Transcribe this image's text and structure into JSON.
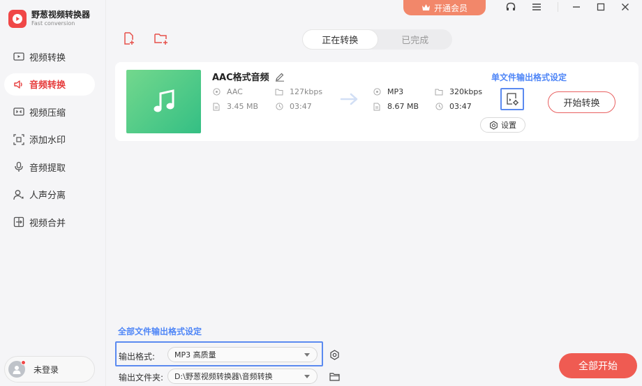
{
  "app": {
    "name": "野葱视频转换器",
    "subtitle": "Fast conversion"
  },
  "topbar": {
    "vip_label": "开通会员",
    "icons": [
      "headset-icon",
      "menu-icon",
      "minimize-icon",
      "maximize-icon",
      "close-icon"
    ]
  },
  "sidebar": {
    "items": [
      {
        "label": "视频转换",
        "icon": "video-convert-icon",
        "active": false
      },
      {
        "label": "音频转换",
        "icon": "audio-convert-icon",
        "active": true
      },
      {
        "label": "视频压缩",
        "icon": "video-compress-icon",
        "active": false
      },
      {
        "label": "添加水印",
        "icon": "watermark-icon",
        "active": false
      },
      {
        "label": "音频提取",
        "icon": "audio-extract-icon",
        "active": false
      },
      {
        "label": "人声分离",
        "icon": "voice-separate-icon",
        "active": false
      },
      {
        "label": "视频合并",
        "icon": "video-merge-icon",
        "active": false
      }
    ],
    "login_label": "未登录"
  },
  "tabs": {
    "converting": "正在转换",
    "completed": "已完成"
  },
  "file": {
    "name": "AAC格式音频",
    "source": {
      "format": "AAC",
      "bitrate": "127kbps",
      "size": "3.45 MB",
      "duration": "03:47"
    },
    "target": {
      "format": "MP3",
      "bitrate": "320kbps",
      "size": "8.67 MB",
      "duration": "03:47"
    },
    "single_output_title": "单文件输出格式设定",
    "settings_label": "设置",
    "start_label": "开始转换"
  },
  "bottom": {
    "all_output_title": "全部文件输出格式设定",
    "format_label": "输出格式:",
    "format_value": "MP3 高质量",
    "folder_label": "输出文件夹:",
    "folder_value": "D:\\野葱视频转换器\\音频转换",
    "start_all_label": "全部开始"
  },
  "colors": {
    "accent_red": "#ef5b52",
    "highlight_blue": "#5b8af0",
    "vip_orange": "#f2876a",
    "thumb_green": "#34bf84"
  }
}
